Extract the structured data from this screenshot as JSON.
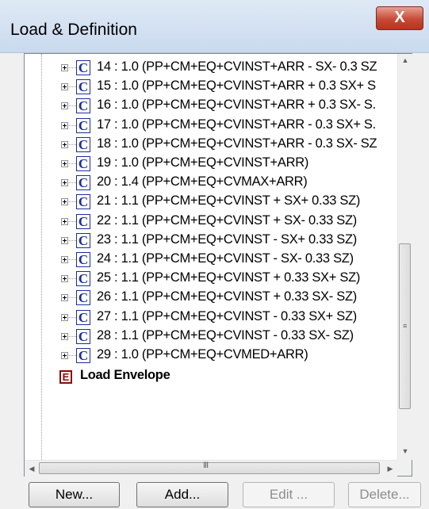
{
  "window": {
    "title": "Load & Definition",
    "close_label": "X"
  },
  "tree": {
    "items": [
      {
        "icon": "C",
        "label": "14 : 1.0 (PP+CM+EQ+CVINST+ARR - SX- 0.3 SZ"
      },
      {
        "icon": "C",
        "label": "15 : 1.0 (PP+CM+EQ+CVINST+ARR + 0.3 SX+ S"
      },
      {
        "icon": "C",
        "label": "16 : 1.0 (PP+CM+EQ+CVINST+ARR + 0.3 SX- S."
      },
      {
        "icon": "C",
        "label": "17 : 1.0 (PP+CM+EQ+CVINST+ARR - 0.3 SX+ S."
      },
      {
        "icon": "C",
        "label": "18 : 1.0 (PP+CM+EQ+CVINST+ARR - 0.3 SX- SZ"
      },
      {
        "icon": "C",
        "label": "19 : 1.0 (PP+CM+EQ+CVINST+ARR)"
      },
      {
        "icon": "C",
        "label": "20 : 1.4 (PP+CM+EQ+CVMAX+ARR)"
      },
      {
        "icon": "C",
        "label": "21 : 1.1 (PP+CM+EQ+CVINST + SX+ 0.33 SZ)"
      },
      {
        "icon": "C",
        "label": "22 : 1.1 (PP+CM+EQ+CVINST + SX- 0.33 SZ)"
      },
      {
        "icon": "C",
        "label": "23 : 1.1 (PP+CM+EQ+CVINST - SX+ 0.33 SZ)"
      },
      {
        "icon": "C",
        "label": "24 : 1.1 (PP+CM+EQ+CVINST - SX- 0.33 SZ)"
      },
      {
        "icon": "C",
        "label": "25 : 1.1 (PP+CM+EQ+CVINST + 0.33 SX+ SZ)"
      },
      {
        "icon": "C",
        "label": "26 : 1.1 (PP+CM+EQ+CVINST + 0.33 SX- SZ)"
      },
      {
        "icon": "C",
        "label": "27 : 1.1 (PP+CM+EQ+CVINST - 0.33 SX+ SZ)"
      },
      {
        "icon": "C",
        "label": "28 : 1.1 (PP+CM+EQ+CVINST - 0.33 SX- SZ)"
      },
      {
        "icon": "C",
        "label": "29 : 1.0 (PP+CM+EQ+CVMED+ARR)"
      }
    ],
    "envelope": {
      "icon": "E",
      "label": "Load Envelope"
    }
  },
  "scrollbar": {
    "h_grip": "III",
    "v_grip": "≡"
  },
  "buttons": {
    "new": "New...",
    "add": "Add...",
    "edit": "Edit ...",
    "delete": "Delete..."
  },
  "colors": {
    "combination_icon": "#1b2d9c",
    "envelope_icon": "#8a0a0a",
    "close_button": "#c74a36"
  }
}
